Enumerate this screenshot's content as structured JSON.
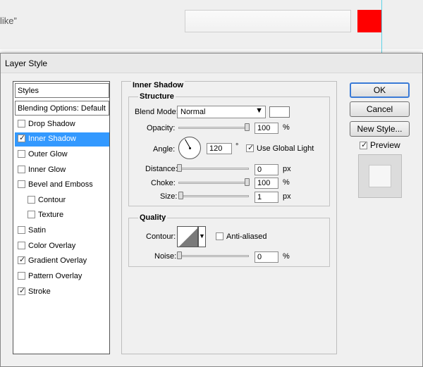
{
  "background": {
    "text": "like”",
    "swatch_color": "#ff0000"
  },
  "dialog": {
    "title": "Layer Style"
  },
  "styles_panel": {
    "header": "Styles",
    "blending": "Blending Options: Default",
    "items": [
      {
        "label": "Drop Shadow",
        "checked": false
      },
      {
        "label": "Inner Shadow",
        "checked": true
      },
      {
        "label": "Outer Glow",
        "checked": false
      },
      {
        "label": "Inner Glow",
        "checked": false
      },
      {
        "label": "Bevel and Emboss",
        "checked": false
      },
      {
        "label": "Contour",
        "checked": false
      },
      {
        "label": "Texture",
        "checked": false
      },
      {
        "label": "Satin",
        "checked": false
      },
      {
        "label": "Color Overlay",
        "checked": false
      },
      {
        "label": "Gradient Overlay",
        "checked": true
      },
      {
        "label": "Pattern Overlay",
        "checked": false
      },
      {
        "label": "Stroke",
        "checked": true
      }
    ]
  },
  "inner_shadow": {
    "section_title": "Inner Shadow",
    "structure_title": "Structure",
    "blend_mode_label": "Blend Mode:",
    "blend_mode_value": "Normal",
    "opacity_label": "Opacity:",
    "opacity_value": "100",
    "opacity_unit": "%",
    "angle_label": "Angle:",
    "angle_value": "120",
    "angle_unit": "°",
    "use_global_light_label": "Use Global Light",
    "use_global_light_checked": true,
    "distance_label": "Distance:",
    "distance_value": "0",
    "distance_unit": "px",
    "choke_label": "Choke:",
    "choke_value": "100",
    "choke_unit": "%",
    "size_label": "Size:",
    "size_value": "1",
    "size_unit": "px",
    "shadow_color": "#ffffff"
  },
  "quality": {
    "title": "Quality",
    "contour_label": "Contour:",
    "anti_aliased_label": "Anti-aliased",
    "anti_aliased_checked": false,
    "noise_label": "Noise:",
    "noise_value": "0",
    "noise_unit": "%"
  },
  "buttons": {
    "ok": "OK",
    "cancel": "Cancel",
    "new_style": "New Style...",
    "preview_label": "Preview",
    "preview_checked": true
  }
}
